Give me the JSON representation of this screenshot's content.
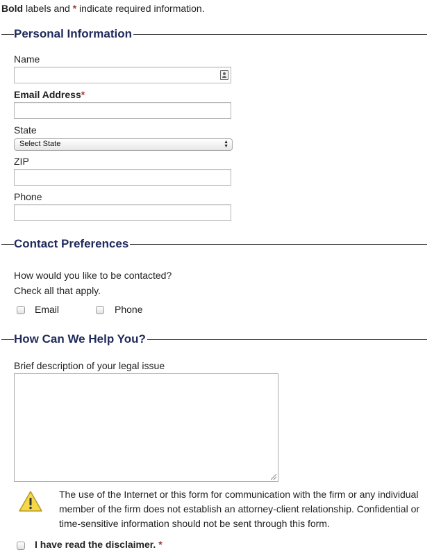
{
  "intro": {
    "bold_word": "Bold",
    "text_mid": " labels and ",
    "star": "*",
    "text_end": " indicate required information."
  },
  "personal": {
    "legend": "Personal Information",
    "name_label": "Name",
    "email_label": "Email Address",
    "email_star": "*",
    "state_label": "State",
    "state_selected": "Select State",
    "zip_label": "ZIP",
    "phone_label": "Phone"
  },
  "contact": {
    "legend": "Contact Preferences",
    "question": "How would you like to be contacted?",
    "hint": "Check all that apply.",
    "options": [
      "Email",
      "Phone"
    ]
  },
  "help": {
    "legend": "How Can We Help You?",
    "description_label": "Brief description of your legal issue"
  },
  "disclaimer": {
    "text": "The use of the Internet or this form for communication with the firm or any individual member of the firm does not establish an attorney-client relationship. Confidential or time-sensitive information should not be sent through this form.",
    "ack_label": "I have read the disclaimer.",
    "ack_star": "*"
  },
  "colors": {
    "legend": "#1f2a5c",
    "required_star": "#a23a3a",
    "warning_fill": "#f5d84a"
  },
  "icons": {
    "autofill": "contact-card-icon",
    "warning": "warning-triangle-icon",
    "select": "chevron-up-down-icon",
    "textarea": "resize-grip-icon"
  }
}
